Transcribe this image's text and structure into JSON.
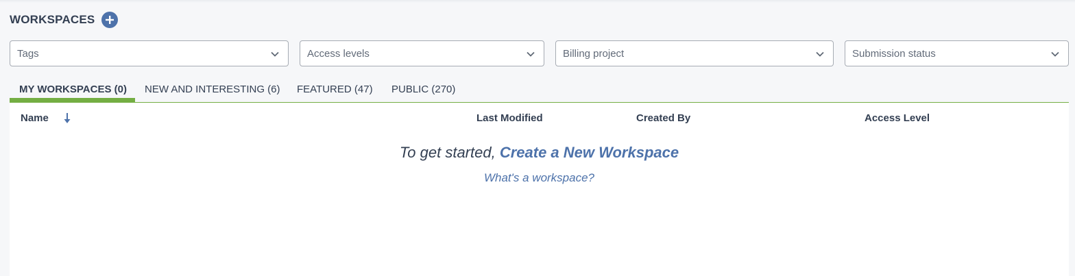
{
  "header": {
    "title": "WORKSPACES",
    "add_icon": "plus-circle-icon"
  },
  "filters": [
    {
      "placeholder": "Tags"
    },
    {
      "placeholder": "Access levels"
    },
    {
      "placeholder": "Billing project"
    },
    {
      "placeholder": "Submission status"
    }
  ],
  "tabs": [
    {
      "label": "MY WORKSPACES (0)",
      "active": true
    },
    {
      "label": "NEW AND INTERESTING (6)",
      "active": false
    },
    {
      "label": "FEATURED (47)",
      "active": false
    },
    {
      "label": "PUBLIC (270)",
      "active": false
    }
  ],
  "table": {
    "columns": [
      "Name",
      "Last Modified",
      "Created By",
      "Access Level"
    ],
    "sort_icon": "arrow-down-icon"
  },
  "empty_state": {
    "prefix": "To get started, ",
    "link": "Create a New Workspace",
    "help": "What's a workspace?"
  },
  "colors": {
    "accent": "#4d72aa",
    "tab_underline": "#74ae43",
    "text": "#333f52"
  }
}
